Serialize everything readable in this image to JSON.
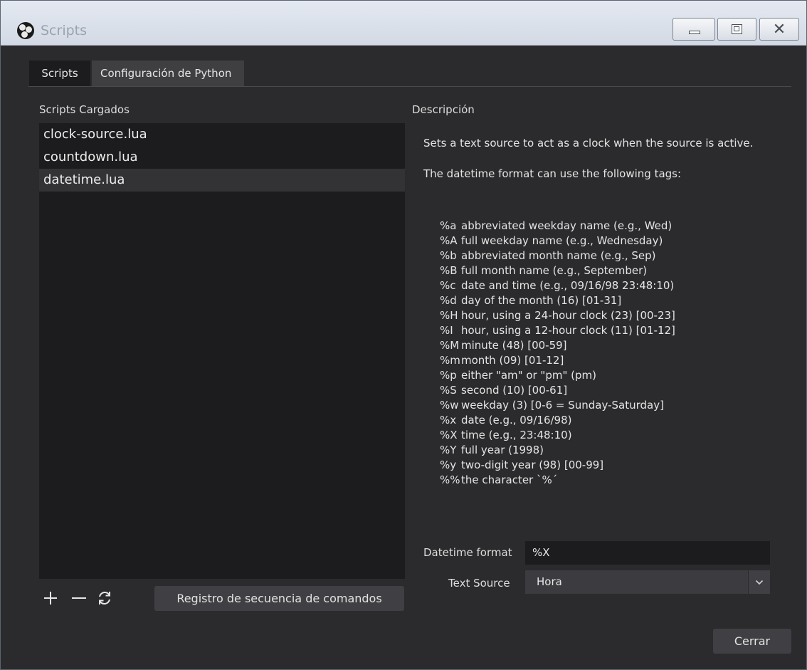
{
  "window": {
    "title": "Scripts"
  },
  "tabs": [
    {
      "label": "Scripts"
    },
    {
      "label": "Configuración de Python"
    }
  ],
  "left_panel": {
    "label": "Scripts Cargados",
    "scripts": [
      "clock-source.lua",
      "countdown.lua",
      "datetime.lua"
    ],
    "selected_index": 2,
    "log_button_label": "Registro de secuencia de comandos"
  },
  "right_panel": {
    "label": "Descripción",
    "description_1": "Sets a text source to act as a clock when the source is active.",
    "description_2": "The datetime format can use the following tags:",
    "tags": [
      {
        "code": "%a",
        "text": "abbreviated weekday name (e.g., Wed)"
      },
      {
        "code": "%A",
        "text": "full weekday name (e.g., Wednesday)"
      },
      {
        "code": "%b",
        "text": "abbreviated month name (e.g., Sep)"
      },
      {
        "code": "%B",
        "text": "full month name (e.g., September)"
      },
      {
        "code": "%c",
        "text": "date and time (e.g., 09/16/98 23:48:10)"
      },
      {
        "code": "%d",
        "text": "day of the month (16) [01-31]"
      },
      {
        "code": "%H",
        "text": "hour, using a 24-hour clock (23) [00-23]"
      },
      {
        "code": "%I",
        "text": "hour, using a 12-hour clock (11) [01-12]"
      },
      {
        "code": "%M",
        "text": "minute (48) [00-59]"
      },
      {
        "code": "%m",
        "text": "month (09) [01-12]"
      },
      {
        "code": "%p",
        "text": "either \"am\" or \"pm\" (pm)"
      },
      {
        "code": "%S",
        "text": "second (10) [00-61]"
      },
      {
        "code": "%w",
        "text": "weekday (3) [0-6 = Sunday-Saturday]"
      },
      {
        "code": "%x",
        "text": "date (e.g., 09/16/98)"
      },
      {
        "code": "%X",
        "text": "time (e.g., 23:48:10)"
      },
      {
        "code": "%Y",
        "text": "full year (1998)"
      },
      {
        "code": "%y",
        "text": "two-digit year (98) [00-99]"
      },
      {
        "code": "%%",
        "text": "the character `%´"
      }
    ]
  },
  "form": {
    "datetime_label": "Datetime format",
    "datetime_value": "%X",
    "text_source_label": "Text Source",
    "text_source_value": "Hora"
  },
  "footer": {
    "close_label": "Cerrar"
  },
  "icons": {
    "add": "plus-icon",
    "remove": "minus-icon",
    "reload": "reload-icon"
  }
}
